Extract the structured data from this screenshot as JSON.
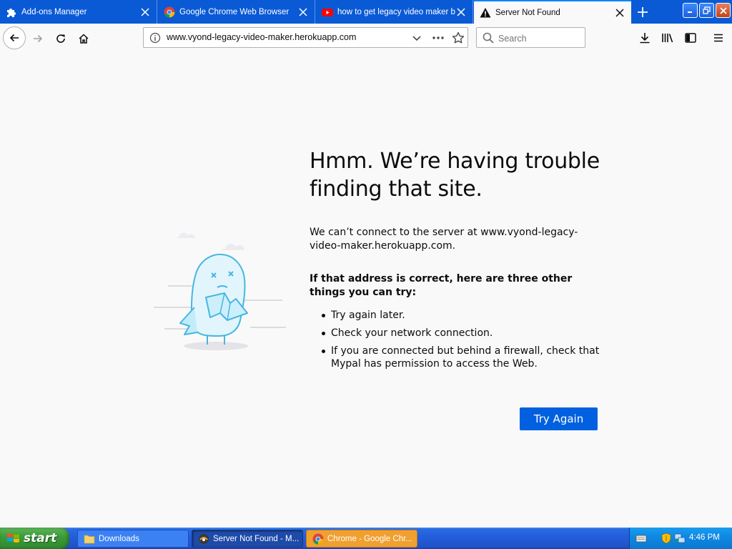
{
  "browser": {
    "tabs": [
      {
        "title": "Add-ons Manager",
        "icon": "puzzle-icon",
        "active": false
      },
      {
        "title": "Google Chrome Web Browser",
        "icon": "chrome-icon",
        "active": false
      },
      {
        "title": "how to get legacy video maker ba",
        "icon": "youtube-icon",
        "active": false
      },
      {
        "title": "Server Not Found",
        "icon": "warning-icon",
        "active": true
      }
    ],
    "url": "www.vyond-legacy-video-maker.herokuapp.com",
    "search_placeholder": "Search",
    "accent_color": "#0a5ad6"
  },
  "error_page": {
    "title": "Hmm. We’re having trouble finding that site.",
    "description": "We can’t connect to the server at www.vyond-legacy-video-maker.herokuapp.com.",
    "suggestions_heading": "If that address is correct, here are three other things you can try:",
    "suggestions": [
      "Try again later.",
      "Check your network connection.",
      "If you are connected but behind a firewall, check that Mypal has permission to access the Web."
    ],
    "try_again_label": "Try Again",
    "button_color": "#0060df"
  },
  "taskbar": {
    "start_label": "start",
    "items": [
      {
        "label": "Downloads",
        "icon": "folder-icon"
      },
      {
        "label": "Server Not Found - M...",
        "icon": "mypal-icon"
      },
      {
        "label": "Chrome - Google Chr...",
        "icon": "chrome-icon"
      }
    ],
    "clock": "4:46 PM"
  }
}
